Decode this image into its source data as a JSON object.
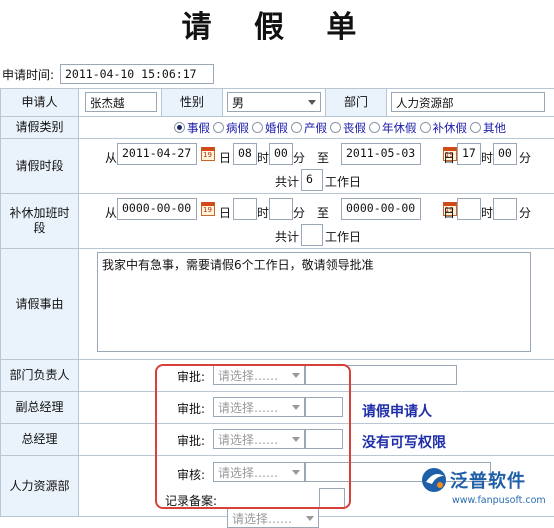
{
  "title": "请 假 单",
  "apply_time": {
    "label": "申请时间:",
    "value": "2011-04-10 15:06:17"
  },
  "rows": {
    "applicant": {
      "label": "申请人",
      "value": "张杰越"
    },
    "gender": {
      "label": "性别",
      "value": "男"
    },
    "department": {
      "label": "部门",
      "value": "人力资源部"
    },
    "leave_type": {
      "label": "请假类别",
      "options": [
        "事假",
        "病假",
        "婚假",
        "产假",
        "丧假",
        "年休假",
        "补休假",
        "其他"
      ],
      "selected": "事假"
    },
    "leave_period": {
      "label": "请假时段",
      "from_label": "从",
      "start_date": "2011-04-27",
      "start_day_unit": "日",
      "start_hour": "08",
      "hour_unit": "时",
      "start_min": "00",
      "min_unit": "分",
      "to_label": "至",
      "end_date": "2011-05-03",
      "end_hour": "17",
      "end_min": "00",
      "total_label": "共计",
      "total_days": "6",
      "total_unit": "工作日"
    },
    "comp_period": {
      "label": "补休加班时段",
      "from_label": "从",
      "start_date": "0000-00-00",
      "start_hour": "",
      "start_min": "",
      "to_label": "至",
      "end_date": "0000-00-00",
      "end_hour": "",
      "end_min": "",
      "total_label": "共计",
      "total_days": "",
      "total_unit": "工作日"
    },
    "reason": {
      "label": "请假事由",
      "value": "我家中有急事，需要请假6个工作日，敬请领导批准"
    },
    "dept_head": {
      "label": "部门负责人",
      "action": "审批:",
      "placeholder": "请选择……"
    },
    "vp": {
      "label": "副总经理",
      "action": "审批:",
      "placeholder": "请选择……"
    },
    "gm": {
      "label": "总经理",
      "action": "审批:",
      "placeholder": "请选择……"
    },
    "hr": {
      "label": "人力资源部",
      "action": "审核:",
      "placeholder": "请选择……",
      "record_label": "记录备案:",
      "record_placeholder": "请选择……"
    }
  },
  "annotations": {
    "line1": "请假申请人",
    "line2": "没有可写权限"
  },
  "logo": {
    "name": "泛普软件",
    "url": "www.fanpusoft.com"
  },
  "colors": {
    "label_bg": "#eaf2fb",
    "annotation_box": "#d9403a",
    "annotation_text": "#1f2fa8"
  }
}
